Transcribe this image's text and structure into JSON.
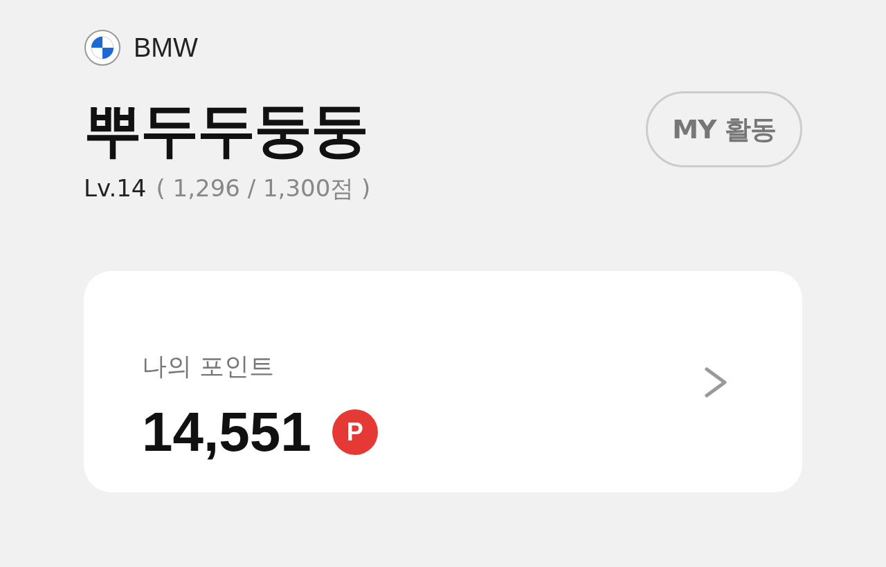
{
  "brand": {
    "name": "BMW"
  },
  "profile": {
    "nickname": "뿌두두둥둥",
    "level": "Lv.14",
    "progress": "( 1,296 / 1,300점 )",
    "activity_button": "MY 활동"
  },
  "points_card": {
    "label": "나의 포인트",
    "value": "14,551",
    "badge": "P"
  }
}
